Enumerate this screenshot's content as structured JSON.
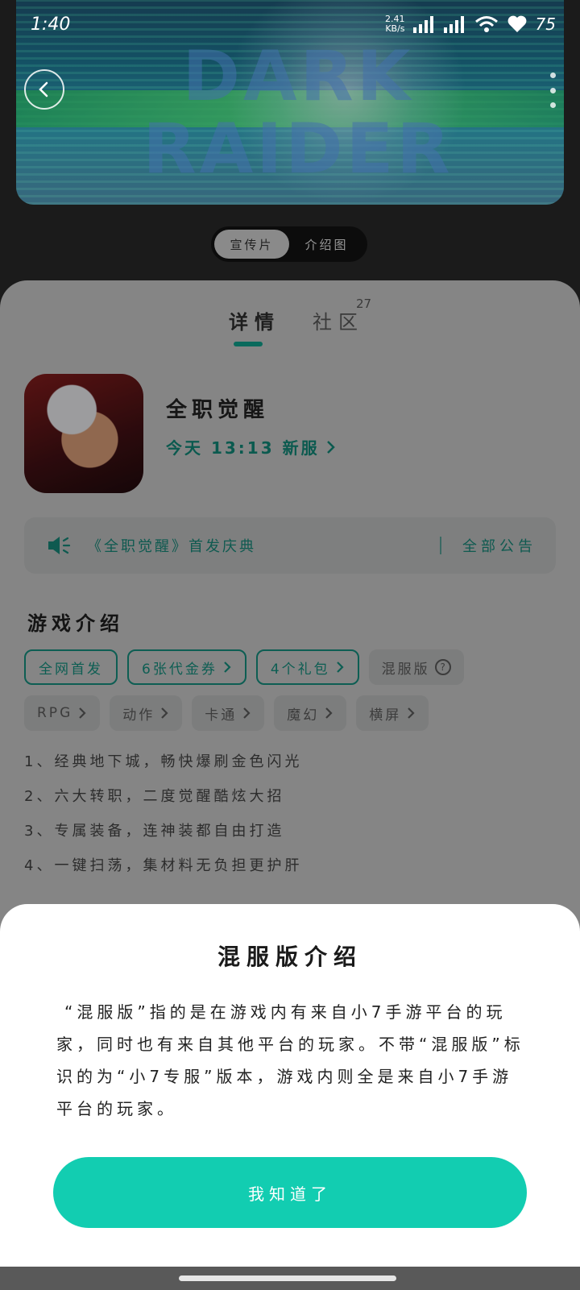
{
  "status_bar": {
    "time": "1:40",
    "net_speed_value": "2.41",
    "net_speed_unit": "KB/s",
    "battery": "75"
  },
  "hero": {
    "art_text": "DARK RAIDER"
  },
  "media_toggle": {
    "video_label": "宣传片",
    "images_label": "介绍图"
  },
  "tabs": {
    "details_label": "详情",
    "community_label": "社区",
    "community_count": "27"
  },
  "game": {
    "title": "全职觉醒",
    "server_info": "今天 13:13 新服"
  },
  "notice": {
    "text": "《全职觉醒》首发庆典",
    "all_label": "全部公告"
  },
  "intro": {
    "title": "游戏介绍",
    "tags_row1": [
      {
        "label": "全网首发"
      },
      {
        "label": "6张代金券"
      },
      {
        "label": "4个礼包"
      },
      {
        "label": "混服版"
      }
    ],
    "tags_row2": [
      {
        "label": "RPG"
      },
      {
        "label": "动作"
      },
      {
        "label": "卡通"
      },
      {
        "label": "魔幻"
      },
      {
        "label": "横屏"
      }
    ],
    "features": [
      "1、经典地下城，畅快爆刷金色闪光",
      "2、六大转职，二度觉醒酷炫大招",
      "3、专属装备，连神装都自由打造",
      "4、一键扫荡，集材料无负担更护肝"
    ]
  },
  "sheet": {
    "title": "混服版介绍",
    "body": "“混服版”指的是在游戏内有来自小7手游平台的玩家，同时也有来自其他平台的玩家。不带“混服版”标识的为“小7专服”版本，游戏内则全是来自小7手游平台的玩家。",
    "confirm_label": "我知道了"
  },
  "colors": {
    "accent": "#12cdb1",
    "dim_accent": "#0d5e53"
  }
}
